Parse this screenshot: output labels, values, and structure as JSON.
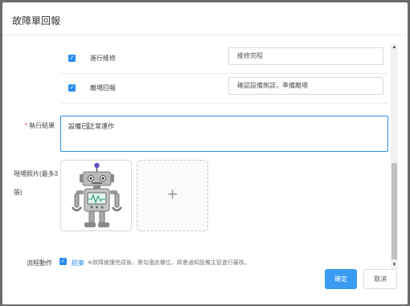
{
  "dialog": {
    "title": "故障單回報",
    "tasks": [
      {
        "label": "進行維修",
        "value": "維修完程",
        "checked": true
      },
      {
        "label": "離場回報",
        "value": "確認設備無誤，準備離場",
        "checked": true
      }
    ],
    "result": {
      "required_mark": "*",
      "label": "執行結果",
      "value_before_caret": "設備已",
      "value_after_caret": "正常運作"
    },
    "photos": {
      "label": "現場照片(最多3張)",
      "add_symbol": "+"
    },
    "flow": {
      "label": "流程動作",
      "checkbox_mark": "✓",
      "link": "結案",
      "note": "※故障維護完成後，需勾選此欄位，將會通知設備主管進行審核。"
    },
    "buttons": {
      "ok": "確定",
      "cancel": "取消"
    },
    "scroll": {
      "up": "▲",
      "down": "▼"
    }
  },
  "colors": {
    "accent": "#2b8ef0",
    "required": "#e23c3c"
  }
}
